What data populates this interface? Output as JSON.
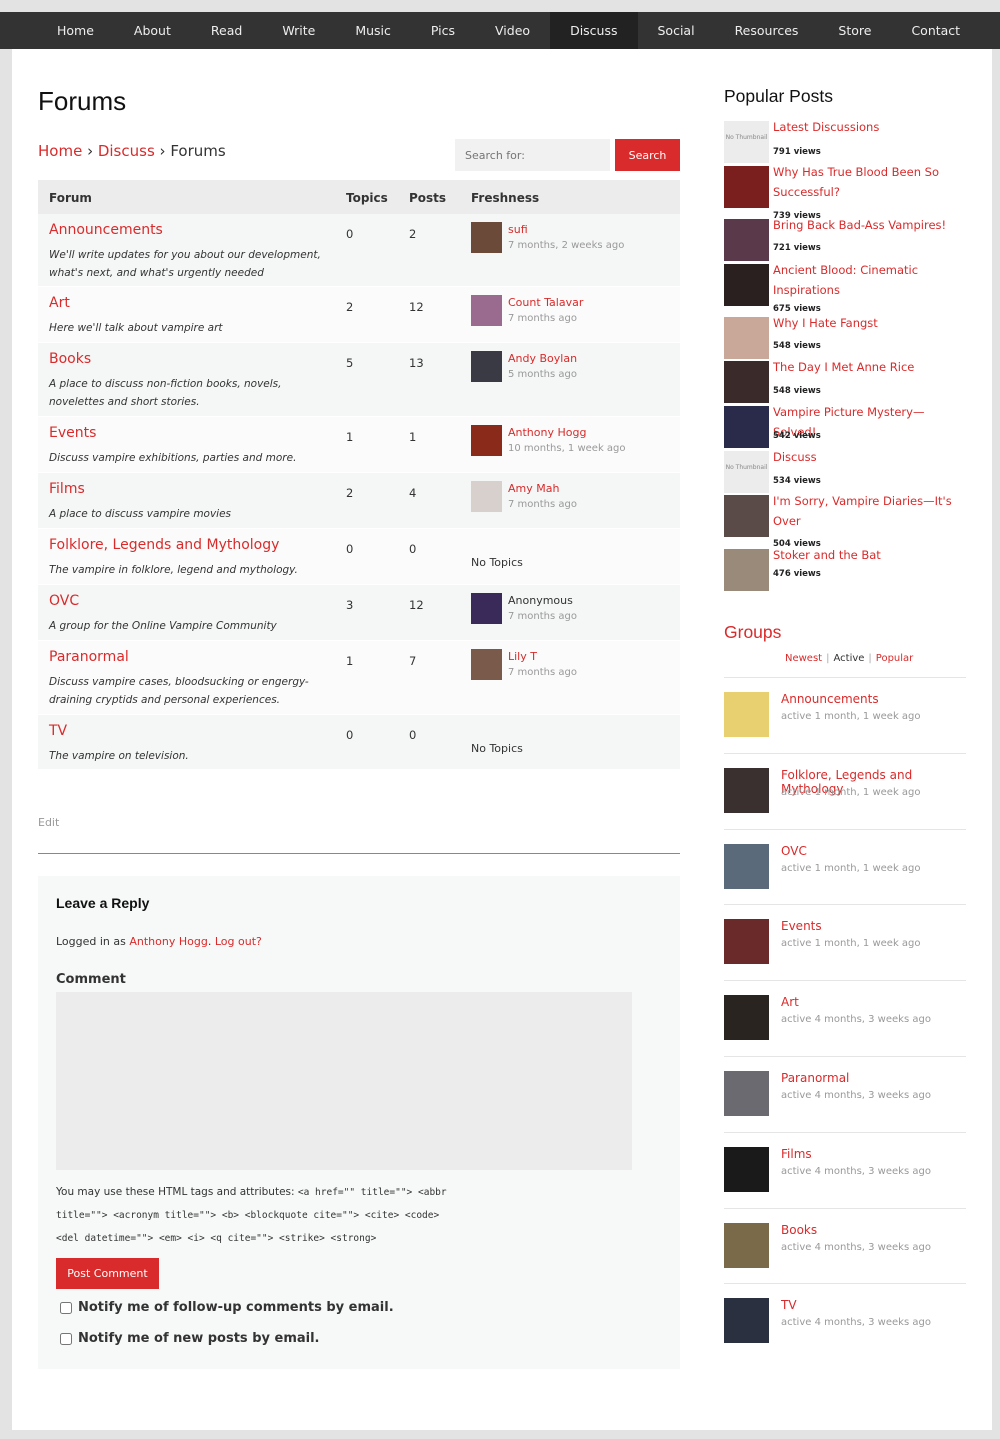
{
  "nav": [
    "Home",
    "About",
    "Read",
    "Write",
    "Music",
    "Pics",
    "Video",
    "Discuss",
    "Social",
    "Resources",
    "Store",
    "Contact"
  ],
  "nav_active": "Discuss",
  "page_title": "Forums",
  "breadcrumb": {
    "home": "Home",
    "sep1": " › ",
    "discuss": "Discuss",
    "sep2": " › ",
    "current": "Forums"
  },
  "search": {
    "placeholder": "Search for:",
    "button": "Search"
  },
  "forum_table": {
    "headers": {
      "forum": "Forum",
      "topics": "Topics",
      "posts": "Posts",
      "freshness": "Freshness"
    },
    "rows": [
      {
        "name": "Announcements",
        "desc": "We'll write updates for you about our development, what's next, and what's urgently needed",
        "topics": "0",
        "posts": "2",
        "user": "sufi",
        "time": "7 months, 2 weeks ago",
        "height": 73,
        "avatar": "#6b4a3a"
      },
      {
        "name": "Art",
        "desc": "Here we'll talk about vampire art",
        "topics": "2",
        "posts": "12",
        "user": "Count Talavar",
        "time": "7 months ago",
        "height": 56,
        "avatar": "#9b6b8f"
      },
      {
        "name": "Books",
        "desc": "A place to discuss non-fiction books, novels, novelettes and short stories.",
        "topics": "5",
        "posts": "13",
        "user": "Andy Boylan",
        "time": "5 months ago",
        "height": 74,
        "avatar": "#3a3a44"
      },
      {
        "name": "Events",
        "desc": "Discuss vampire exhibitions, parties and more.",
        "topics": "1",
        "posts": "1",
        "user": "Anthony Hogg",
        "time": "10 months, 1 week ago",
        "height": 56,
        "avatar": "#8a2a1a"
      },
      {
        "name": "Films",
        "desc": "A place to discuss vampire movies",
        "topics": "2",
        "posts": "4",
        "user": "Amy Mah",
        "time": "7 months ago",
        "height": 56,
        "avatar": "#d8d0cc"
      },
      {
        "name": "Folklore, Legends and Mythology",
        "desc": "The vampire in folklore, legend and mythology.",
        "topics": "0",
        "posts": "0",
        "user": "",
        "time": "",
        "notopics": "No Topics",
        "height": 56,
        "avatar": ""
      },
      {
        "name": "OVC",
        "desc": "A group for the Online Vampire Community",
        "topics": "3",
        "posts": "12",
        "user": "Anonymous",
        "anon": true,
        "time": "7 months ago",
        "height": 56,
        "avatar": "#3a2a5a"
      },
      {
        "name": "Paranormal",
        "desc": "Discuss vampire cases, bloodsucking or engergy-draining cryptids and personal experiences.",
        "topics": "1",
        "posts": "7",
        "user": "Lily T",
        "time": "7 months ago",
        "height": 74,
        "avatar": "#7a5a4a"
      },
      {
        "name": "TV",
        "desc": "The vampire on television.",
        "topics": "0",
        "posts": "0",
        "user": "",
        "time": "",
        "notopics": "No Topics",
        "height": 55,
        "avatar": ""
      }
    ]
  },
  "edit_link": "Edit",
  "reply": {
    "title": "Leave a Reply",
    "logged_prefix": "Logged in as ",
    "logged_user": "Anthony Hogg",
    "logged_dot": ". ",
    "logout": "Log out?",
    "comment_label": "Comment",
    "tags_prefix": "You may use these HTML tags and attributes: ",
    "tags_code": "<a href=\"\" title=\"\"> <abbr title=\"\"> <acronym title=\"\"> <b> <blockquote cite=\"\"> <cite> <code> <del datetime=\"\"> <em> <i> <q cite=\"\"> <strike> <strong>",
    "post_button": "Post Comment",
    "notify_comments": "Notify me of follow-up comments by email.",
    "notify_posts": "Notify me of new posts by email."
  },
  "popular_posts": {
    "title": "Popular Posts",
    "items": [
      {
        "title": "Latest Discussions",
        "views": "791 views",
        "thumb": "No Thumbnail"
      },
      {
        "title": "Why Has True Blood Been So Successful?",
        "views": "739 views",
        "thumb": ""
      },
      {
        "title": "Bring Back Bad-Ass Vampires!",
        "views": "721 views",
        "thumb": ""
      },
      {
        "title": "Ancient Blood: Cinematic Inspirations",
        "views": "675 views",
        "thumb": ""
      },
      {
        "title": "Why I Hate Fangst",
        "views": "548 views",
        "thumb": ""
      },
      {
        "title": "The Day I Met Anne Rice",
        "views": "548 views",
        "thumb": ""
      },
      {
        "title": "Vampire Picture Mystery—Solved!",
        "views": "542 views",
        "thumb": ""
      },
      {
        "title": "Discuss",
        "views": "534 views",
        "thumb": "No Thumbnail"
      },
      {
        "title": "I'm Sorry, Vampire Diaries—It's Over",
        "views": "504 views",
        "thumb": ""
      },
      {
        "title": "Stoker and the Bat",
        "views": "476 views",
        "thumb": ""
      }
    ]
  },
  "groups": {
    "title": "Groups",
    "tabs": [
      "Newest",
      "Active",
      "Popular"
    ],
    "active_tab": "Active",
    "items": [
      {
        "name": "Announcements",
        "time": "active 1 month, 1 week ago"
      },
      {
        "name": "Folklore, Legends and Mythology",
        "time": "active 1 month, 1 week ago"
      },
      {
        "name": "OVC",
        "time": "active 1 month, 1 week ago"
      },
      {
        "name": "Events",
        "time": "active 1 month, 1 week ago"
      },
      {
        "name": "Art",
        "time": "active 4 months, 3 weeks ago"
      },
      {
        "name": "Paranormal",
        "time": "active 4 months, 3 weeks ago"
      },
      {
        "name": "Films",
        "time": "active 4 months, 3 weeks ago"
      },
      {
        "name": "Books",
        "time": "active 4 months, 3 weeks ago"
      },
      {
        "name": "TV",
        "time": "active 4 months, 3 weeks ago"
      }
    ]
  },
  "colors": {
    "accent": "#d92b2b",
    "nav_bg": "#333333"
  }
}
